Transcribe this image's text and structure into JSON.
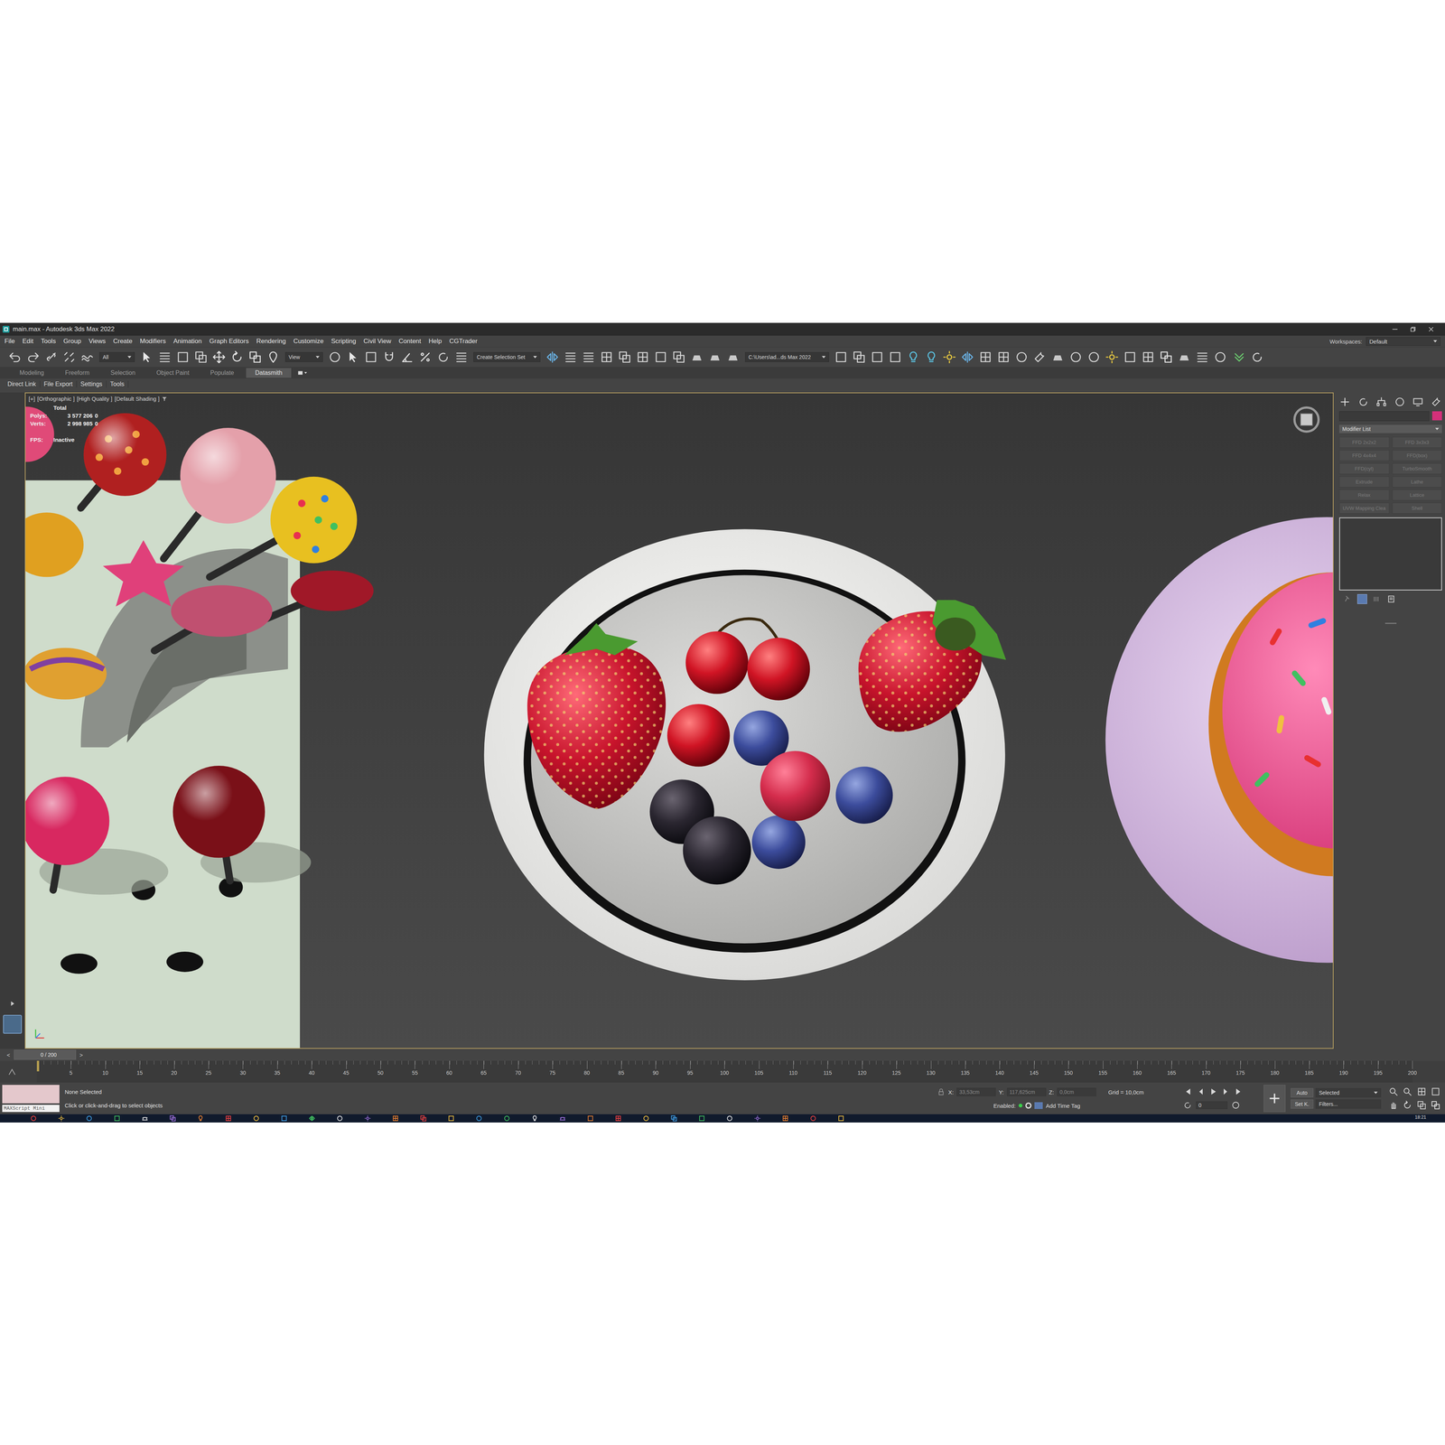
{
  "window": {
    "title": "main.max - Autodesk 3ds Max 2022"
  },
  "menu": [
    "File",
    "Edit",
    "Tools",
    "Group",
    "Views",
    "Create",
    "Modifiers",
    "Animation",
    "Graph Editors",
    "Rendering",
    "Customize",
    "Scripting",
    "Civil View",
    "Content",
    "Help",
    "CGTrader"
  ],
  "workspaces": {
    "label": "Workspaces:",
    "value": "Default"
  },
  "toolbar": {
    "filter": "All",
    "ref_coord": "View",
    "selection_set": "Create Selection Set",
    "project_path": "C:\\Users\\ad...ds Max 2022"
  },
  "ribbon_tabs": [
    {
      "label": "Modeling",
      "selected": false
    },
    {
      "label": "Freeform",
      "selected": false
    },
    {
      "label": "Selection",
      "selected": false
    },
    {
      "label": "Object Paint",
      "selected": false
    },
    {
      "label": "Populate",
      "selected": false
    },
    {
      "label": "Datasmith",
      "selected": true
    }
  ],
  "ribbon_commands": [
    "Direct Link",
    "File Export",
    "Settings",
    "Tools"
  ],
  "viewport": {
    "label_parts": [
      "[+]",
      "[Orthographic ]",
      "[High Quality ]",
      "[Default Shading ]"
    ],
    "stats": {
      "title": "Total",
      "rows": [
        {
          "label": "Polys:",
          "value": "3 577 206",
          "selected_value": "0"
        },
        {
          "label": "Verts:",
          "value": "2 998 985",
          "selected_value": "0"
        }
      ],
      "fps_label": "FPS:",
      "fps": "Inactive"
    }
  },
  "command_panel": {
    "modifier_list": "Modifier List",
    "buttons": [
      {
        "label": "FFD 2x2x2",
        "disabled": true
      },
      {
        "label": "FFD 3x3x3",
        "disabled": true
      },
      {
        "label": "FFD 4x4x4",
        "disabled": true
      },
      {
        "label": "FFD(box)",
        "disabled": true
      },
      {
        "label": "FFD(cyl)",
        "disabled": true
      },
      {
        "label": "TurboSmooth",
        "disabled": true
      },
      {
        "label": "Extrude",
        "disabled": true
      },
      {
        "label": "Lathe",
        "disabled": true
      },
      {
        "label": "Relax",
        "disabled": true
      },
      {
        "label": "Lattice",
        "disabled": true
      },
      {
        "label": "UVW Mapping Clea",
        "disabled": true
      },
      {
        "label": "Shell",
        "disabled": true
      }
    ]
  },
  "timeline": {
    "position": "0 / 200",
    "prev": "<",
    "next": ">",
    "level": 0,
    "ticks": [
      "5",
      "10",
      "15",
      "20",
      "25",
      "30",
      "35",
      "40",
      "45",
      "50",
      "55",
      "60",
      "65",
      "70",
      "75",
      "80",
      "85",
      "90",
      "95",
      "100",
      "105",
      "110",
      "115",
      "120",
      "125",
      "130",
      "135",
      "140",
      "145",
      "150",
      "155",
      "160",
      "165",
      "170",
      "175",
      "180",
      "185",
      "190",
      "195",
      "200"
    ]
  },
  "status": {
    "maxscript": "MAXScript Mini",
    "selection": "None Selected",
    "prompt": "Click or click-and-drag to select objects",
    "coords": [
      {
        "label": "X:",
        "value": "33,53cm"
      },
      {
        "label": "Y:",
        "value": "117,625cm"
      },
      {
        "label": "Z:",
        "value": "0,0cm"
      }
    ],
    "grid": "Grid = 10,0cm",
    "enabled_label": "Enabled:",
    "enabled": true,
    "time_tag": "Add Time Tag",
    "auto": "Auto",
    "key_filter": "Selected",
    "set_key": "Set K.",
    "filters": "Filters...",
    "frame": "0"
  },
  "taskbar": {
    "clock": "18:21"
  }
}
